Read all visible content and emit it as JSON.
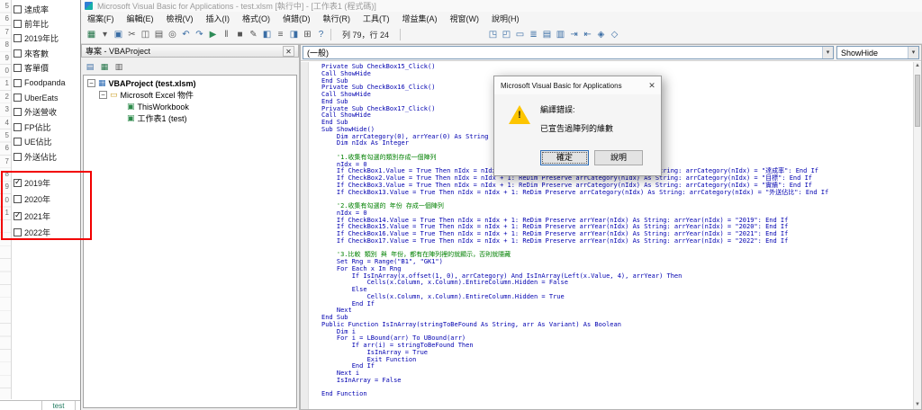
{
  "ui": {
    "dropdown_arrow": "▾",
    "close_glyph": "✕",
    "scroll_up": "▲",
    "scroll_down": "▼",
    "warning_exclamation": "!"
  },
  "excel_panel": {
    "row_digits": [
      "5",
      "6",
      "7",
      "8",
      "9",
      "0",
      "1",
      "2",
      "3",
      "4",
      "5",
      "6",
      "7",
      "8",
      "9",
      "0",
      "1"
    ],
    "category_checkboxes": [
      {
        "label": "達成率",
        "checked": false
      },
      {
        "label": "前年比",
        "checked": false
      },
      {
        "label": "2019年比",
        "checked": false
      },
      {
        "label": "來客數",
        "checked": false
      },
      {
        "label": "客單價",
        "checked": false
      },
      {
        "label": "Foodpanda",
        "checked": false
      },
      {
        "label": "UberEats",
        "checked": false
      },
      {
        "label": "外送營收",
        "checked": false
      },
      {
        "label": "FP佔比",
        "checked": false
      },
      {
        "label": "UE佔比",
        "checked": false
      },
      {
        "label": "外送佔比",
        "checked": false
      }
    ],
    "year_checkboxes": [
      {
        "label": "2019年",
        "checked": true
      },
      {
        "label": "2020年",
        "checked": false
      },
      {
        "label": "2021年",
        "checked": true
      },
      {
        "label": "2022年",
        "checked": false
      }
    ],
    "highlight_color": "#f20000",
    "sheet_tab": "test"
  },
  "vba_window": {
    "title": "Microsoft Visual Basic for Applications - test.xlsm [執行中] - [工作表1 (程式碼)]",
    "menus": [
      "檔案(F)",
      "編輯(E)",
      "檢視(V)",
      "插入(I)",
      "格式(O)",
      "偵錯(D)",
      "執行(R)",
      "工具(T)",
      "增益集(A)",
      "視窗(W)",
      "說明(H)"
    ],
    "toolbar": {
      "position_text": "列 79，行 24",
      "left_icons": [
        {
          "name": "view-excel-icon",
          "glyph": "▦",
          "c": "ic-green"
        },
        {
          "name": "insert-object-dropdown-icon",
          "glyph": "▾",
          "c": "ic-dim"
        },
        {
          "name": "save-icon",
          "glyph": "▣",
          "c": "ic-blue"
        },
        {
          "name": "cut-icon",
          "glyph": "✂",
          "c": "ic-dim"
        },
        {
          "name": "copy-icon",
          "glyph": "◫",
          "c": "ic-dim"
        },
        {
          "name": "paste-icon",
          "glyph": "▤",
          "c": "ic-dim"
        },
        {
          "name": "find-icon",
          "glyph": "◎",
          "c": "ic-dim"
        },
        {
          "name": "undo-icon",
          "glyph": "↶",
          "c": "ic-blue"
        },
        {
          "name": "redo-icon",
          "glyph": "↷",
          "c": "ic-blue"
        },
        {
          "name": "run-icon",
          "glyph": "▶",
          "c": "ic-run"
        },
        {
          "name": "break-icon",
          "glyph": "‖",
          "c": "ic-dim"
        },
        {
          "name": "reset-icon",
          "glyph": "■",
          "c": "ic-dim"
        },
        {
          "name": "design-mode-icon",
          "glyph": "✎",
          "c": "ic-dim"
        },
        {
          "name": "project-explorer-icon",
          "glyph": "◧",
          "c": "ic-blue"
        },
        {
          "name": "properties-window-icon",
          "glyph": "≡",
          "c": "ic-dim"
        },
        {
          "name": "object-browser-icon",
          "glyph": "◨",
          "c": "ic-blue"
        },
        {
          "name": "toolbox-icon",
          "glyph": "⊞",
          "c": "ic-dim"
        },
        {
          "name": "help-icon",
          "glyph": "?",
          "c": "ic-blue"
        }
      ],
      "right_icons": [
        {
          "name": "watch-window-icon",
          "glyph": "◳",
          "c": "ic-blue"
        },
        {
          "name": "locals-window-icon",
          "glyph": "◰",
          "c": "ic-blue"
        },
        {
          "name": "immediate-window-icon",
          "glyph": "▭",
          "c": "ic-blue"
        },
        {
          "name": "call-stack-icon",
          "glyph": "≣",
          "c": "ic-blue"
        },
        {
          "name": "comment-block-icon",
          "glyph": "▤",
          "c": "ic-blue"
        },
        {
          "name": "uncomment-block-icon",
          "glyph": "▥",
          "c": "ic-blue"
        },
        {
          "name": "indent-icon",
          "glyph": "⇥",
          "c": "ic-blue"
        },
        {
          "name": "outdent-icon",
          "glyph": "⇤",
          "c": "ic-blue"
        },
        {
          "name": "toggle-bookmark-icon",
          "glyph": "◈",
          "c": "ic-blue"
        },
        {
          "name": "clear-bookmarks-icon",
          "glyph": "◇",
          "c": "ic-blue"
        }
      ]
    },
    "project_panel": {
      "title": "專案 - VBAProject",
      "panel_icons": [
        {
          "name": "view-code-icon",
          "glyph": "▤",
          "c": "ic-blue"
        },
        {
          "name": "view-object-icon",
          "glyph": "▦",
          "c": "ic-green"
        },
        {
          "name": "toggle-folders-icon",
          "glyph": "▥",
          "c": "ic-dim"
        }
      ],
      "tree": [
        {
          "label": "VBAProject (test.xlsm)",
          "ind": "i0",
          "bold": true,
          "exp": true,
          "icon": "ic-proj",
          "glyph": "▦"
        },
        {
          "label": "Microsoft Excel 物件",
          "ind": "i1",
          "bold": false,
          "exp": true,
          "icon": "ic-folder",
          "glyph": "▭"
        },
        {
          "label": "ThisWorkbook",
          "ind": "i2",
          "bold": false,
          "exp": false,
          "icon": "ic-sheet",
          "glyph": "▣"
        },
        {
          "label": "工作表1 (test)",
          "ind": "i2",
          "bold": false,
          "exp": false,
          "icon": "ic-sheet",
          "glyph": "▣"
        }
      ]
    },
    "code_pane": {
      "object_dropdown": "(一般)",
      "procedure_dropdown": "ShowHide",
      "lines": [
        {
          "t": "Private Sub CheckBox15_Click()",
          "c": "code"
        },
        {
          "t": "Call ShowHide",
          "c": "code"
        },
        {
          "t": "End Sub",
          "c": "code"
        },
        {
          "t": "Private Sub CheckBox16_Click()",
          "c": "code"
        },
        {
          "t": "Call ShowHide",
          "c": "code"
        },
        {
          "t": "End Sub",
          "c": "code"
        },
        {
          "t": "Private Sub CheckBox17_Click()",
          "c": "code"
        },
        {
          "t": "Call ShowHide",
          "c": "code"
        },
        {
          "t": "End Sub",
          "c": "code"
        },
        {
          "t": "Sub ShowHide()",
          "c": "code"
        },
        {
          "t": "    Dim arrCategory(0), arrYear(0) As String",
          "c": "code"
        },
        {
          "t": "    Dim nIdx As Integer",
          "c": "code"
        },
        {
          "t": "",
          "c": "code"
        },
        {
          "t": "    '1.收集有勾選的類別存成一個陣列",
          "c": "cmt"
        },
        {
          "t": "    nIdx = 0",
          "c": "code"
        },
        {
          "t": "    If CheckBox1.Value = True Then nIdx = nIdx + 1: ReDim Preserve arrCategory(nIdx) As String: arrCategory(nIdx) = \"達成率\": End If",
          "c": "code"
        },
        {
          "t": "    If CheckBox2.Value = True Then nIdx = nIdx + 1: ReDim Preserve arrCategory(nIdx) As String: arrCategory(nIdx) = \"目標\": End If",
          "c": "code"
        },
        {
          "t": "    If CheckBox3.Value = True Then nIdx = nIdx + 1: ReDim Preserve arrCategory(nIdx) As String: arrCategory(nIdx) = \"實績\": End If",
          "c": "code"
        },
        {
          "t": "    If CheckBox13.Value = True Then nIdx = nIdx + 1: ReDim Preserve arrCategory(nIdx) As String: arrCategory(nIdx) = \"外送佔比\": End If",
          "c": "code"
        },
        {
          "t": "",
          "c": "code"
        },
        {
          "t": "    '2.收集有勾選的 年份 存成一個陣列",
          "c": "cmt"
        },
        {
          "t": "    nIdx = 0",
          "c": "code"
        },
        {
          "t": "    If CheckBox14.Value = True Then nIdx = nIdx + 1: ReDim Preserve arrYear(nIdx) As String: arrYear(nIdx) = \"2019\": End If",
          "c": "code"
        },
        {
          "t": "    If CheckBox15.Value = True Then nIdx = nIdx + 1: ReDim Preserve arrYear(nIdx) As String: arrYear(nIdx) = \"2020\": End If",
          "c": "code"
        },
        {
          "t": "    If CheckBox16.Value = True Then nIdx = nIdx + 1: ReDim Preserve arrYear(nIdx) As String: arrYear(nIdx) = \"2021\": End If",
          "c": "code"
        },
        {
          "t": "    If CheckBox17.Value = True Then nIdx = nIdx + 1: ReDim Preserve arrYear(nIdx) As String: arrYear(nIdx) = \"2022\": End If",
          "c": "code"
        },
        {
          "t": "",
          "c": "code"
        },
        {
          "t": "    '3.比較 類別 與 年份，都有在陣列裡的就顯示，否則就隱藏",
          "c": "cmt"
        },
        {
          "t": "    Set Rng = Range(\"B1\", \"GK1\")",
          "c": "code"
        },
        {
          "t": "    For Each x In Rng",
          "c": "code"
        },
        {
          "t": "        If IsInArray(x.offset(1, 0), arrCategory) And IsInArray(Left(x.Value, 4), arrYear) Then",
          "c": "code"
        },
        {
          "t": "            Cells(x.Column, x.Column).EntireColumn.Hidden = False",
          "c": "code"
        },
        {
          "t": "        Else",
          "c": "code"
        },
        {
          "t": "            Cells(x.Column, x.Column).EntireColumn.Hidden = True",
          "c": "code"
        },
        {
          "t": "        End If",
          "c": "code"
        },
        {
          "t": "    Next",
          "c": "code"
        },
        {
          "t": "End Sub",
          "c": "code"
        },
        {
          "t": "Public Function IsInArray(stringToBeFound As String, arr As Variant) As Boolean",
          "c": "code"
        },
        {
          "t": "    Dim i",
          "c": "code"
        },
        {
          "t": "    For i = LBound(arr) To UBound(arr)",
          "c": "code"
        },
        {
          "t": "        If arr(i) = stringToBeFound Then",
          "c": "code"
        },
        {
          "t": "            IsInArray = True",
          "c": "code"
        },
        {
          "t": "            Exit Function",
          "c": "code"
        },
        {
          "t": "        End If",
          "c": "code"
        },
        {
          "t": "    Next i",
          "c": "code"
        },
        {
          "t": "    IsInArray = False",
          "c": "code"
        },
        {
          "t": "",
          "c": "code"
        },
        {
          "t": "End Function",
          "c": "code"
        }
      ]
    }
  },
  "dialog": {
    "title": "Microsoft Visual Basic for Applications",
    "error_heading": "編譯錯誤:",
    "error_message": "已宣告過陣列的維數",
    "ok_label": "確定",
    "help_label": "說明",
    "warning_color": "#fdc500"
  }
}
